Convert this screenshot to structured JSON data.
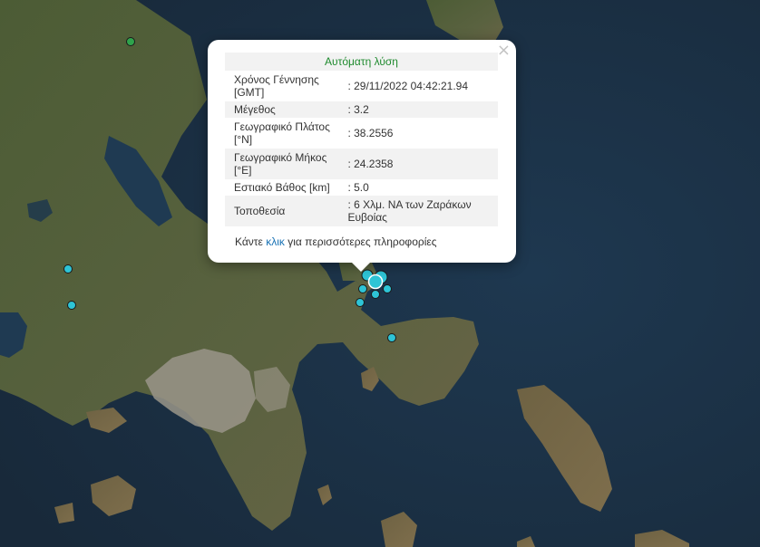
{
  "popup": {
    "close_symbol": "×",
    "title": "Αυτόματη λύση",
    "rows": [
      {
        "label": "Χρόνος Γέννησης [GMT]",
        "value": ": 29/11/2022 04:42:21.94"
      },
      {
        "label": "Μέγεθος",
        "value": ": 3.2"
      },
      {
        "label": "Γεωγραφικό Πλάτος [°N]",
        "value": ": 38.2556"
      },
      {
        "label": "Γεωγραφικό Μήκος [°E]",
        "value": ": 24.2358"
      },
      {
        "label": "Εστιακό Βάθος [km]",
        "value": ": 5.0"
      },
      {
        "label": "Τοποθεσία",
        "value": ": 6 Χλμ. ΝΑ των Ζαράκων Ευβοίας"
      }
    ],
    "more_prefix": "Κάντε ",
    "more_link": "κλικ",
    "more_suffix": " για περισσότερες πληροφορίες"
  },
  "colors": {
    "sea": "#1c3347",
    "land": "#4a5a36",
    "urban": "#9a958a",
    "marker_cyan": "#2ec4d6",
    "marker_green": "#2fa34c",
    "title_green": "#1f8a2e",
    "link_blue": "#1a73b5"
  },
  "markers": [
    {
      "name": "marker-north",
      "color": "green"
    },
    {
      "name": "marker-west-1",
      "color": "cyan"
    },
    {
      "name": "marker-west-2",
      "color": "cyan"
    },
    {
      "name": "marker-cluster-selected",
      "color": "cyan"
    },
    {
      "name": "marker-cluster-2",
      "color": "cyan"
    },
    {
      "name": "marker-cluster-3",
      "color": "cyan"
    },
    {
      "name": "marker-cluster-4",
      "color": "cyan"
    },
    {
      "name": "marker-cluster-5",
      "color": "cyan"
    },
    {
      "name": "marker-cluster-6",
      "color": "cyan"
    },
    {
      "name": "marker-south",
      "color": "cyan"
    }
  ]
}
